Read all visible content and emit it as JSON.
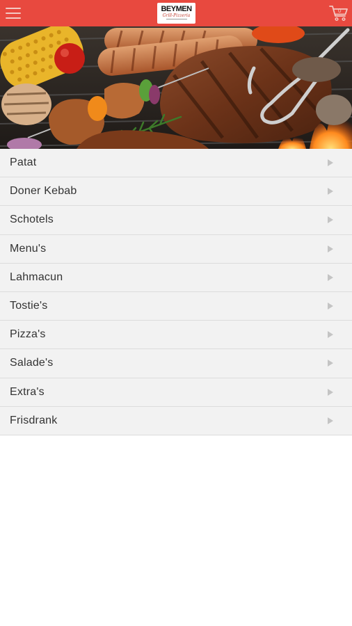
{
  "header": {
    "logo_text": "BEYMEN",
    "logo_subtext": "Grill-Pizzeria",
    "menu_icon": "hamburger-menu-icon",
    "cart_icon": "shopping-cart-icon",
    "cart_count": "0",
    "bar_color": "#e8493f"
  },
  "hero": {
    "image": "grilled-meat-sausages-corn-photo"
  },
  "categories": [
    {
      "label": "Patat"
    },
    {
      "label": "Doner Kebab"
    },
    {
      "label": "Schotels"
    },
    {
      "label": "Menu's"
    },
    {
      "label": "Lahmacun"
    },
    {
      "label": "Tostie's"
    },
    {
      "label": "Pizza's"
    },
    {
      "label": "Salade's"
    },
    {
      "label": "Extra's"
    },
    {
      "label": "Frisdrank"
    }
  ]
}
